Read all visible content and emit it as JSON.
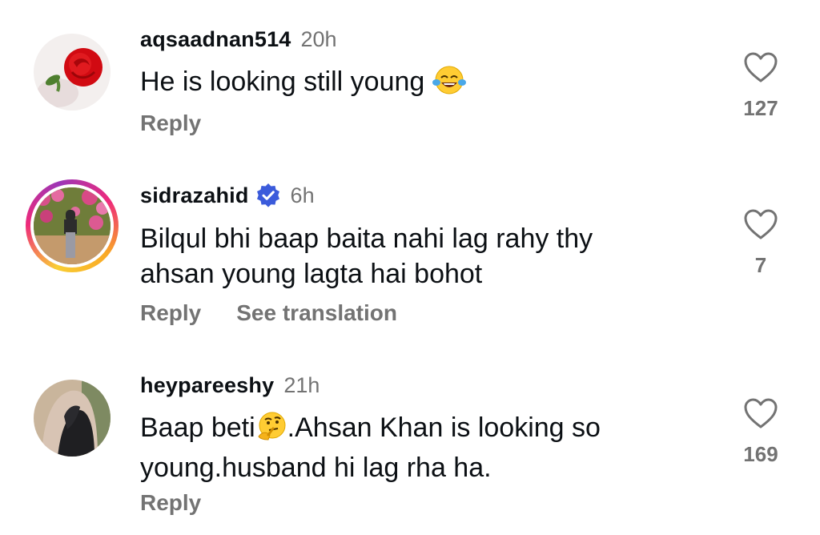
{
  "comments": [
    {
      "username": "aqsaadnan514",
      "time": "20h",
      "text_lines": [
        "He is looking still young"
      ],
      "emoji": "face-with-tears-of-joy",
      "actions": [
        "Reply"
      ],
      "likes": "127",
      "verified": false
    },
    {
      "username": "sidrazahid",
      "time": "6h",
      "text_lines": [
        "Bilqul bhi baap baita nahi lag rahy thy",
        "ahsan young lagta hai bohot"
      ],
      "actions": [
        "Reply",
        "See translation"
      ],
      "likes": "7",
      "verified": true
    },
    {
      "username": "heypareeshy",
      "time": "21h",
      "text_lines": [
        "Baap beti",
        ".Ahsan Khan is looking so",
        "young.husband hi lag rha ha."
      ],
      "emoji": "thinking-face",
      "actions": [
        "Reply"
      ],
      "likes": "169",
      "verified": false
    }
  ],
  "colors": {
    "text": "#0c1014",
    "secondary": "#737373",
    "verified": "#3b5bdb"
  }
}
